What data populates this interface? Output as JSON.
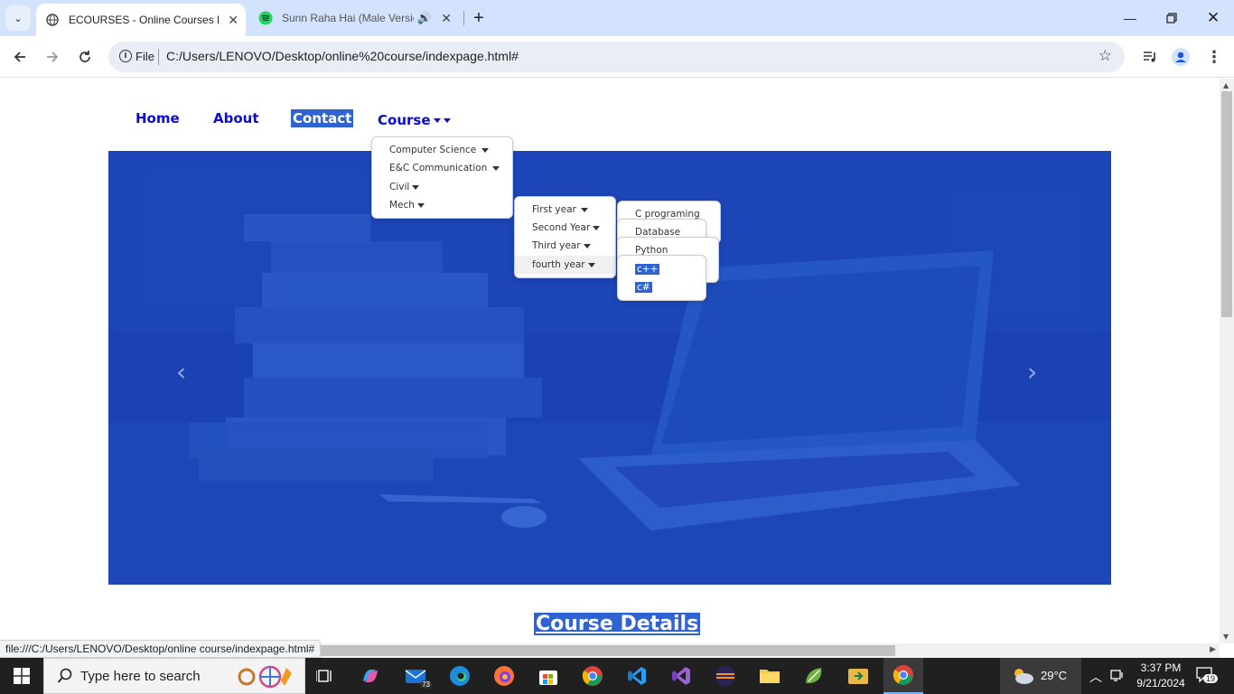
{
  "browser": {
    "tabs": [
      {
        "title": "ECOURSES - Online Courses HT",
        "active": true
      },
      {
        "title": "Sunn Raha Hai (Male Versio",
        "active": false
      }
    ],
    "address": {
      "scheme_chip": "File",
      "url": "C:/Users/LENOVO/Desktop/online%20course/indexpage.html#"
    },
    "status_url": "file:///C:/Users/LENOVO/Desktop/online course/indexpage.html#"
  },
  "site": {
    "nav": {
      "home": "Home",
      "about": "About",
      "contact": "Contact",
      "course": "Course"
    },
    "course_menu": [
      "Computer Science",
      "E&C Communication",
      "Civil",
      "Mech"
    ],
    "year_menu": [
      "First year",
      "Second Year",
      "Third year",
      "fourth year"
    ],
    "subject_menus": {
      "first": [
        "C programing"
      ],
      "second": [
        "Database"
      ],
      "third": [
        "Python"
      ],
      "fourth": [
        "c++",
        "c#"
      ]
    },
    "carousel": {
      "prev": "‹",
      "next": "›"
    },
    "section_heading": "Course Details"
  },
  "taskbar": {
    "search_placeholder": "Type here to search",
    "mail_badge": "73",
    "weather": "29°C",
    "time": "3:37 PM",
    "date": "9/21/2024",
    "notification_count": "19"
  },
  "colors": {
    "nav_link": "#0b0bd6",
    "hero_tint": "#1a42b4",
    "selection": "#3063d2",
    "tab_strip": "#d3e3fd"
  }
}
